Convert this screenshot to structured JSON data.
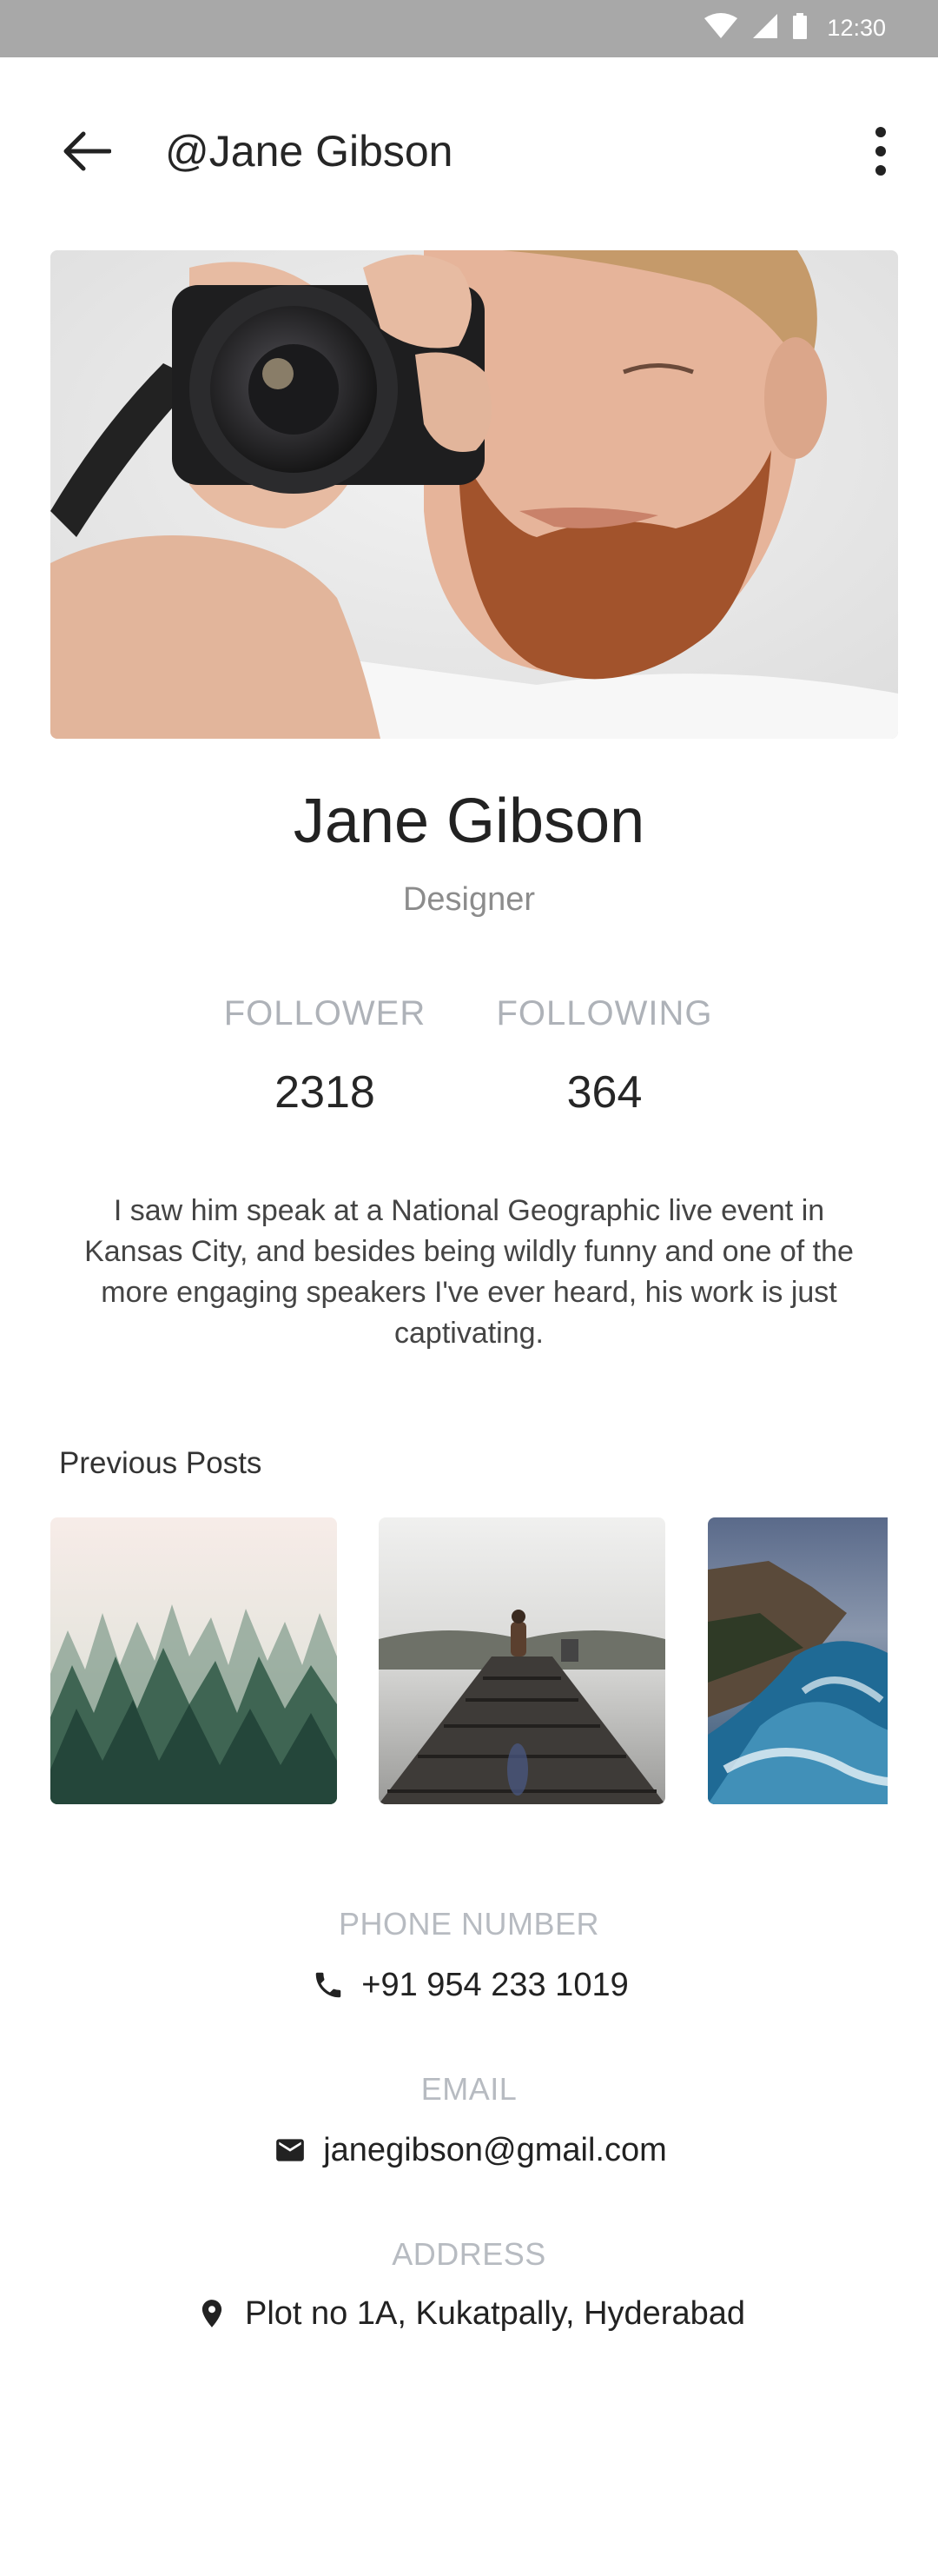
{
  "status_bar": {
    "time": "12:30"
  },
  "app_bar": {
    "title": "@Jane Gibson"
  },
  "profile": {
    "name": "Jane Gibson",
    "role": "Designer"
  },
  "stats": {
    "follower_label": "FOLLOWER",
    "follower_value": "2318",
    "following_label": "FOLLOWING",
    "following_value": "364"
  },
  "bio": "I saw him speak at a National Geographic live event in Kansas City, and besides being wildly funny and one of the more engaging speakers I've ever heard, his work is just captivating.",
  "posts": {
    "title": "Previous Posts"
  },
  "contact": {
    "phone_label": "PHONE NUMBER",
    "phone_value": "+91 954 233 1019",
    "email_label": "EMAIL",
    "email_value": "janegibson@gmail.com",
    "address_label": "ADDRESS",
    "address_value": "Plot no 1A, Kukatpally, Hyderabad"
  },
  "colors": {
    "status_bar": "#a8a8a8",
    "label_gray": "#aeb2b8",
    "text_dark": "#262626"
  }
}
